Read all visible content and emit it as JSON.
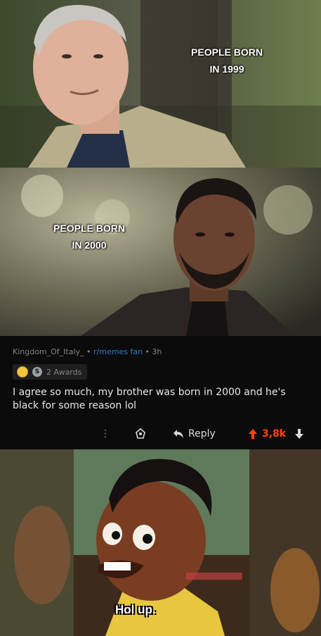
{
  "panel1": {
    "text": "PEOPLE BORN\nIN 1999"
  },
  "panel2": {
    "text": "PEOPLE BORN\nIN 2000"
  },
  "comment": {
    "username": "Kingdom_Of_Italy_",
    "separator1": " • ",
    "flair": "r/memes fan",
    "separator2": " • ",
    "age": "3h",
    "awards_label": "2 Awards",
    "body": "I agree so much, my brother was born in 2000 and he's black for some reason lol",
    "more": "⋮",
    "reply_label": "Reply",
    "score": "3,8k"
  },
  "panel3": {
    "caption": "Hol up."
  },
  "icons": {
    "award_silver_glyph": "S"
  }
}
